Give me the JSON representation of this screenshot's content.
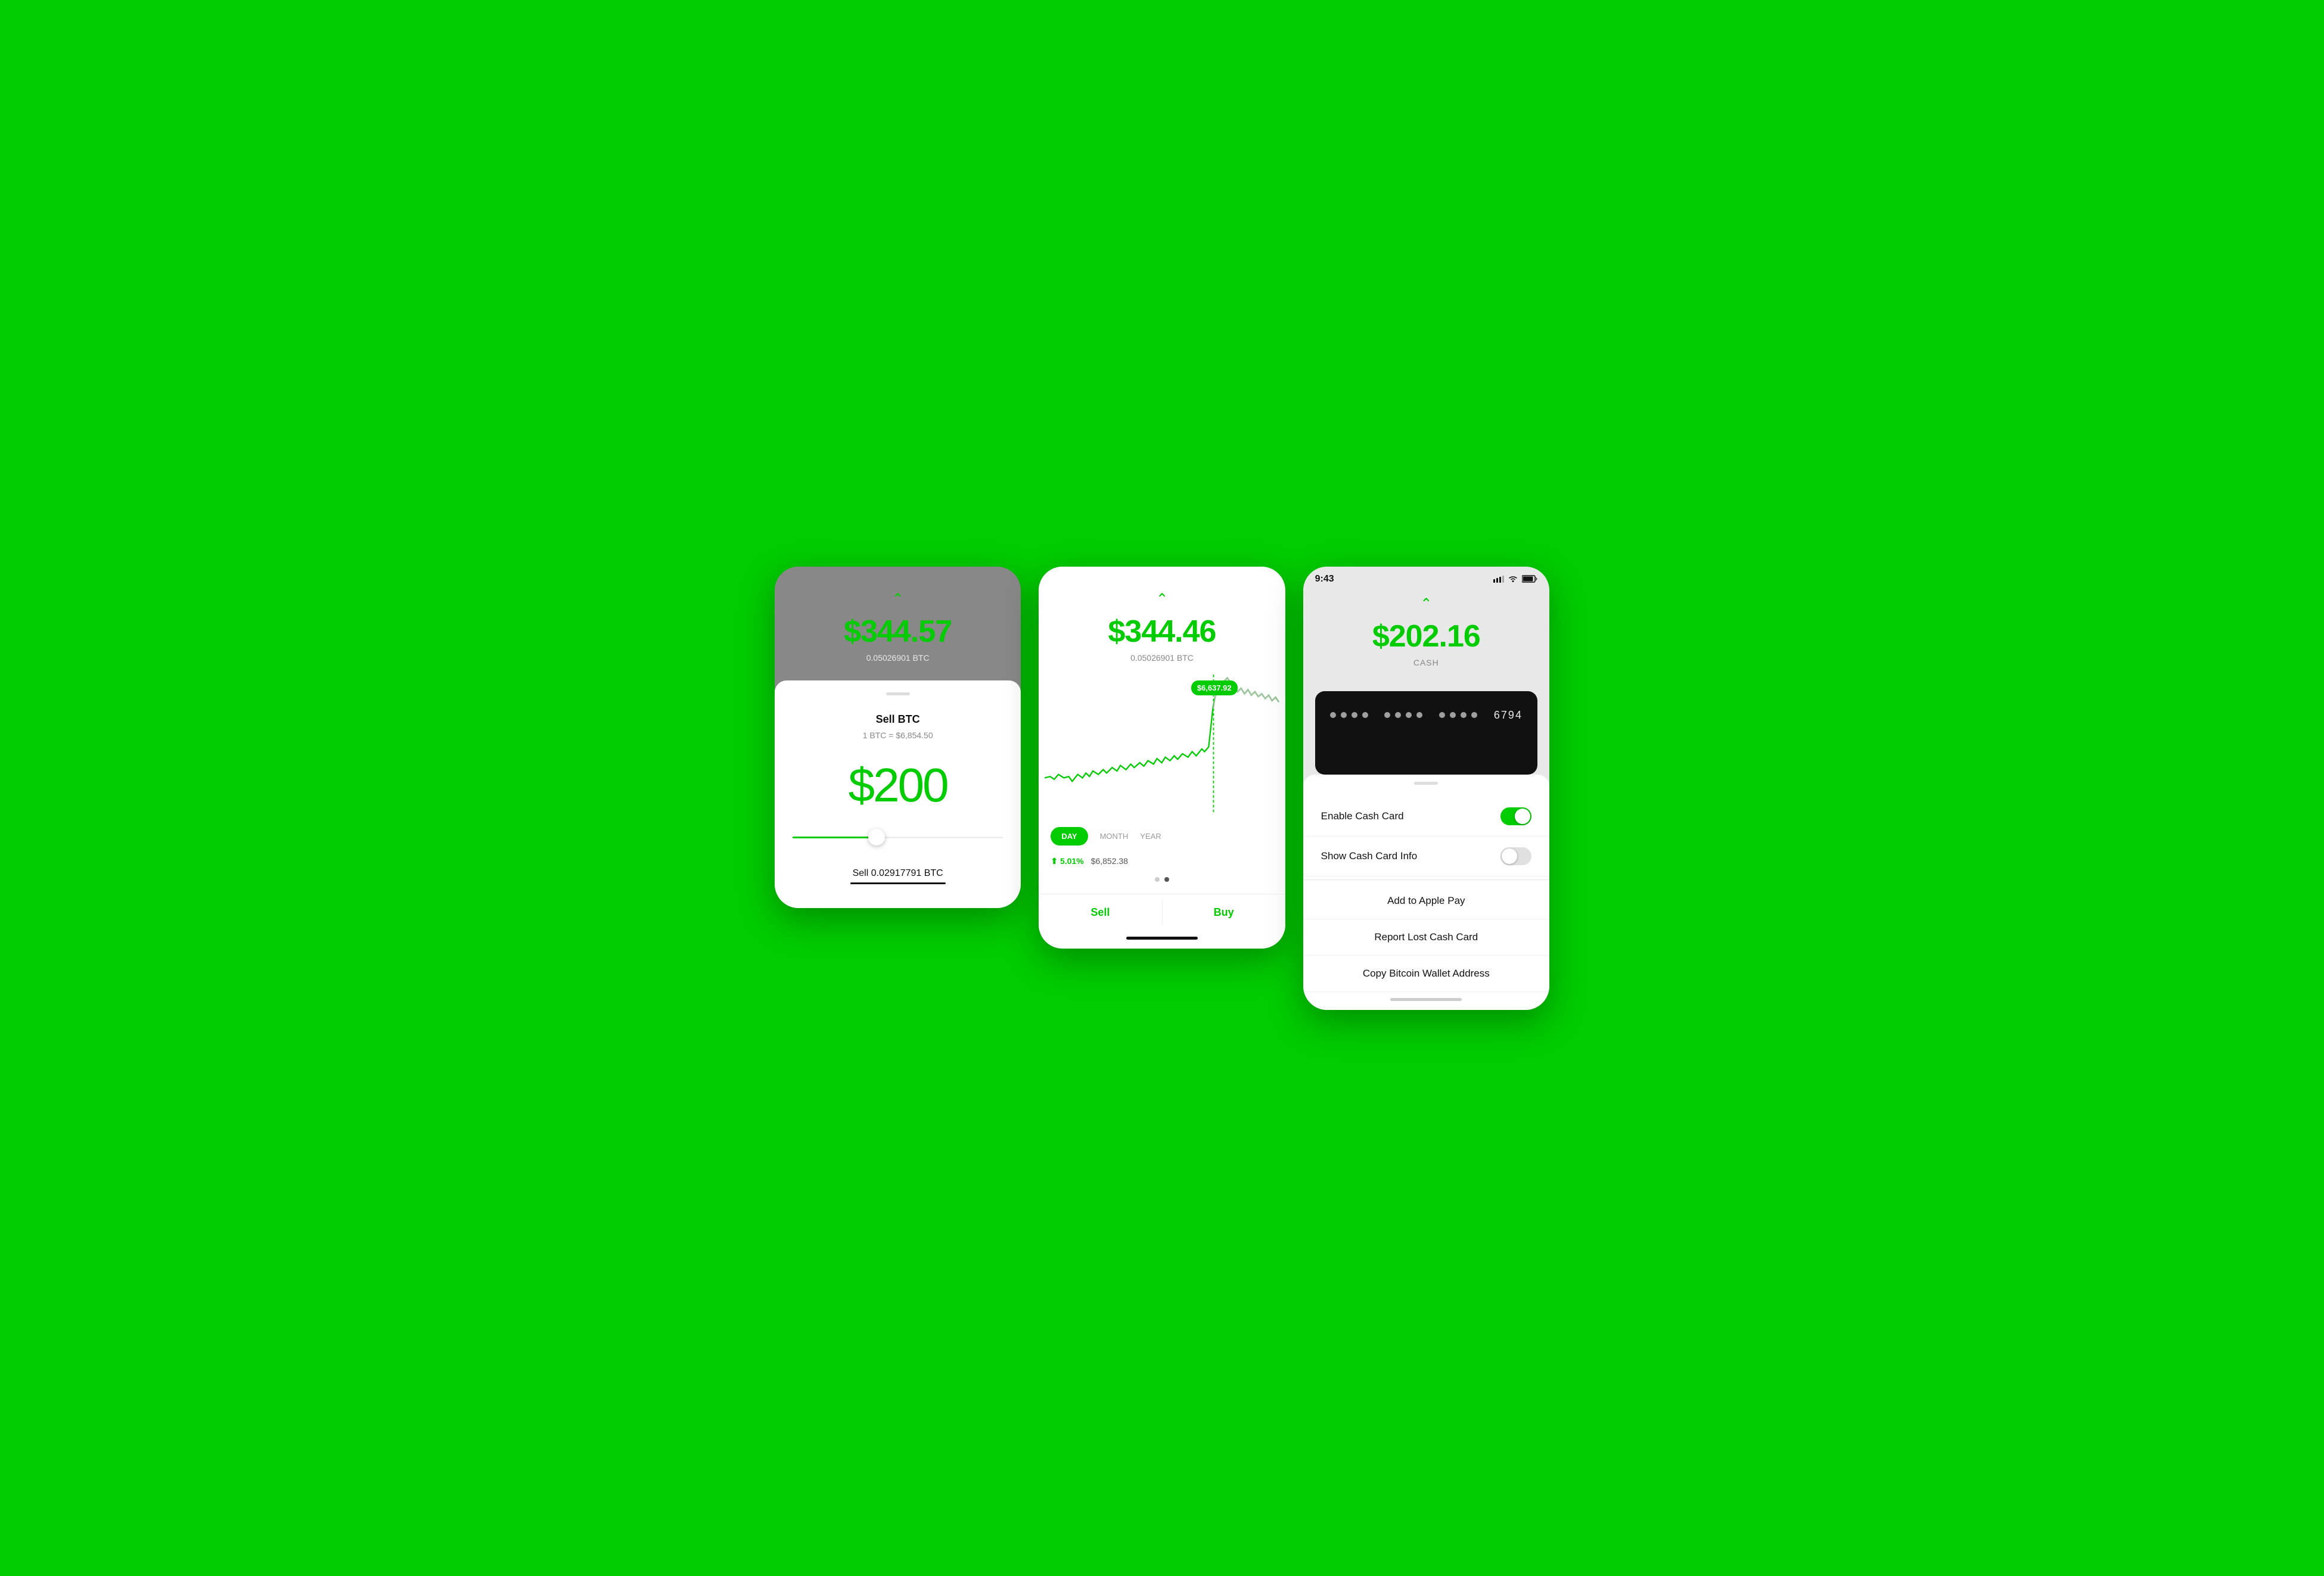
{
  "screen1": {
    "btc_price": "$344.57",
    "btc_sub": "0.05026901 BTC",
    "sell_title": "Sell BTC",
    "sell_rate": "1 BTC = $6,854.50",
    "sell_amount": "$200",
    "sell_btc_label": "Sell 0.02917791 BTC"
  },
  "screen2": {
    "btc_price": "$344.46",
    "btc_sub": "0.05026901 BTC",
    "tooltip_price": "$6,637.92",
    "time_tabs": [
      "DAY",
      "MONTH",
      "YEAR"
    ],
    "active_tab": "DAY",
    "stat_pct": "⬆ 5.01%",
    "stat_price": "$6,852.38",
    "sell_label": "Sell",
    "buy_label": "Buy"
  },
  "screen3": {
    "status_time": "9:43",
    "cash_amount": "$202.16",
    "cash_label": "CASH",
    "card_number_end": "6794",
    "menu_items": [
      {
        "label": "Enable Cash Card",
        "type": "toggle",
        "toggle_on": true
      },
      {
        "label": "Show Cash Card Info",
        "type": "toggle",
        "toggle_on": false
      },
      {
        "label": "Add to Apple Pay",
        "type": "center"
      },
      {
        "label": "Report Lost Cash Card",
        "type": "center"
      },
      {
        "label": "Copy Bitcoin Wallet Address",
        "type": "center"
      }
    ]
  },
  "colors": {
    "green": "#00CC00",
    "dark": "#111111",
    "gray": "#888888"
  }
}
